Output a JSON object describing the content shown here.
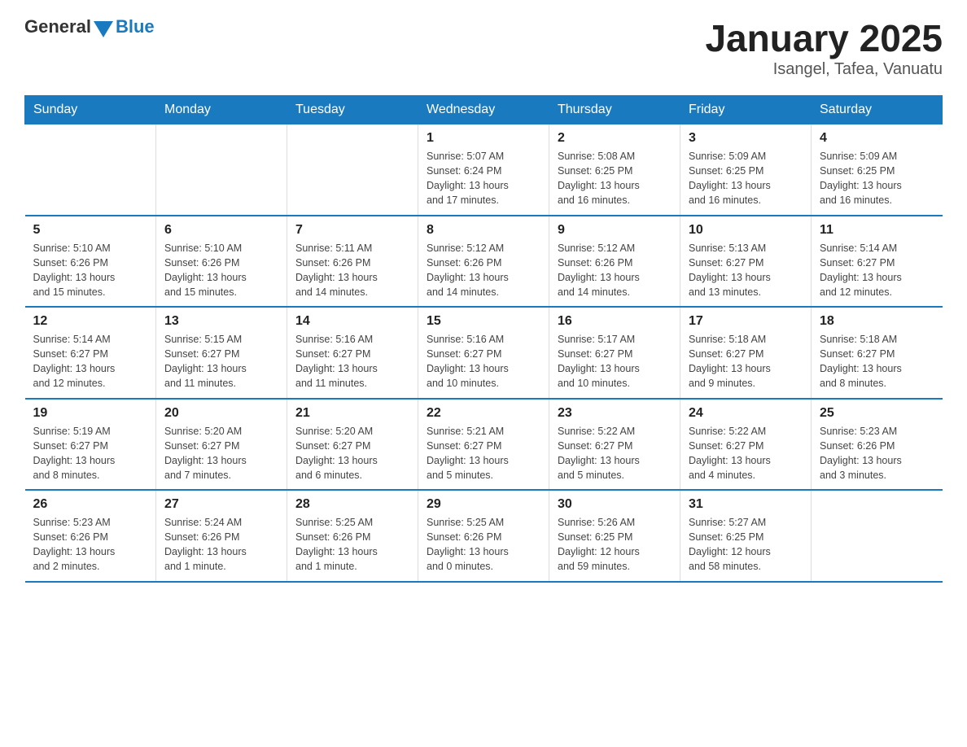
{
  "header": {
    "logo_general": "General",
    "logo_blue": "Blue",
    "month_title": "January 2025",
    "subtitle": "Isangel, Tafea, Vanuatu"
  },
  "days_of_week": [
    "Sunday",
    "Monday",
    "Tuesday",
    "Wednesday",
    "Thursday",
    "Friday",
    "Saturday"
  ],
  "weeks": [
    [
      {
        "day": "",
        "info": ""
      },
      {
        "day": "",
        "info": ""
      },
      {
        "day": "",
        "info": ""
      },
      {
        "day": "1",
        "info": "Sunrise: 5:07 AM\nSunset: 6:24 PM\nDaylight: 13 hours\nand 17 minutes."
      },
      {
        "day": "2",
        "info": "Sunrise: 5:08 AM\nSunset: 6:25 PM\nDaylight: 13 hours\nand 16 minutes."
      },
      {
        "day": "3",
        "info": "Sunrise: 5:09 AM\nSunset: 6:25 PM\nDaylight: 13 hours\nand 16 minutes."
      },
      {
        "day": "4",
        "info": "Sunrise: 5:09 AM\nSunset: 6:25 PM\nDaylight: 13 hours\nand 16 minutes."
      }
    ],
    [
      {
        "day": "5",
        "info": "Sunrise: 5:10 AM\nSunset: 6:26 PM\nDaylight: 13 hours\nand 15 minutes."
      },
      {
        "day": "6",
        "info": "Sunrise: 5:10 AM\nSunset: 6:26 PM\nDaylight: 13 hours\nand 15 minutes."
      },
      {
        "day": "7",
        "info": "Sunrise: 5:11 AM\nSunset: 6:26 PM\nDaylight: 13 hours\nand 14 minutes."
      },
      {
        "day": "8",
        "info": "Sunrise: 5:12 AM\nSunset: 6:26 PM\nDaylight: 13 hours\nand 14 minutes."
      },
      {
        "day": "9",
        "info": "Sunrise: 5:12 AM\nSunset: 6:26 PM\nDaylight: 13 hours\nand 14 minutes."
      },
      {
        "day": "10",
        "info": "Sunrise: 5:13 AM\nSunset: 6:27 PM\nDaylight: 13 hours\nand 13 minutes."
      },
      {
        "day": "11",
        "info": "Sunrise: 5:14 AM\nSunset: 6:27 PM\nDaylight: 13 hours\nand 12 minutes."
      }
    ],
    [
      {
        "day": "12",
        "info": "Sunrise: 5:14 AM\nSunset: 6:27 PM\nDaylight: 13 hours\nand 12 minutes."
      },
      {
        "day": "13",
        "info": "Sunrise: 5:15 AM\nSunset: 6:27 PM\nDaylight: 13 hours\nand 11 minutes."
      },
      {
        "day": "14",
        "info": "Sunrise: 5:16 AM\nSunset: 6:27 PM\nDaylight: 13 hours\nand 11 minutes."
      },
      {
        "day": "15",
        "info": "Sunrise: 5:16 AM\nSunset: 6:27 PM\nDaylight: 13 hours\nand 10 minutes."
      },
      {
        "day": "16",
        "info": "Sunrise: 5:17 AM\nSunset: 6:27 PM\nDaylight: 13 hours\nand 10 minutes."
      },
      {
        "day": "17",
        "info": "Sunrise: 5:18 AM\nSunset: 6:27 PM\nDaylight: 13 hours\nand 9 minutes."
      },
      {
        "day": "18",
        "info": "Sunrise: 5:18 AM\nSunset: 6:27 PM\nDaylight: 13 hours\nand 8 minutes."
      }
    ],
    [
      {
        "day": "19",
        "info": "Sunrise: 5:19 AM\nSunset: 6:27 PM\nDaylight: 13 hours\nand 8 minutes."
      },
      {
        "day": "20",
        "info": "Sunrise: 5:20 AM\nSunset: 6:27 PM\nDaylight: 13 hours\nand 7 minutes."
      },
      {
        "day": "21",
        "info": "Sunrise: 5:20 AM\nSunset: 6:27 PM\nDaylight: 13 hours\nand 6 minutes."
      },
      {
        "day": "22",
        "info": "Sunrise: 5:21 AM\nSunset: 6:27 PM\nDaylight: 13 hours\nand 5 minutes."
      },
      {
        "day": "23",
        "info": "Sunrise: 5:22 AM\nSunset: 6:27 PM\nDaylight: 13 hours\nand 5 minutes."
      },
      {
        "day": "24",
        "info": "Sunrise: 5:22 AM\nSunset: 6:27 PM\nDaylight: 13 hours\nand 4 minutes."
      },
      {
        "day": "25",
        "info": "Sunrise: 5:23 AM\nSunset: 6:26 PM\nDaylight: 13 hours\nand 3 minutes."
      }
    ],
    [
      {
        "day": "26",
        "info": "Sunrise: 5:23 AM\nSunset: 6:26 PM\nDaylight: 13 hours\nand 2 minutes."
      },
      {
        "day": "27",
        "info": "Sunrise: 5:24 AM\nSunset: 6:26 PM\nDaylight: 13 hours\nand 1 minute."
      },
      {
        "day": "28",
        "info": "Sunrise: 5:25 AM\nSunset: 6:26 PM\nDaylight: 13 hours\nand 1 minute."
      },
      {
        "day": "29",
        "info": "Sunrise: 5:25 AM\nSunset: 6:26 PM\nDaylight: 13 hours\nand 0 minutes."
      },
      {
        "day": "30",
        "info": "Sunrise: 5:26 AM\nSunset: 6:25 PM\nDaylight: 12 hours\nand 59 minutes."
      },
      {
        "day": "31",
        "info": "Sunrise: 5:27 AM\nSunset: 6:25 PM\nDaylight: 12 hours\nand 58 minutes."
      },
      {
        "day": "",
        "info": ""
      }
    ]
  ]
}
